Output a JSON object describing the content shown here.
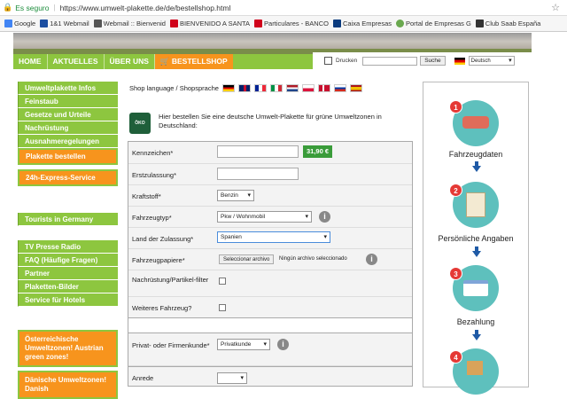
{
  "browser": {
    "security_label": "Es seguro",
    "url": "https://www.umwelt-plakette.de/de/bestellshop.html"
  },
  "bookmarks": [
    {
      "label": "Google",
      "color": "#4285f4"
    },
    {
      "label": "1&1 Webmail",
      "color": "#1c4fa1"
    },
    {
      "label": "Webmail :: Bienvenid",
      "color": "#555555"
    },
    {
      "label": "BIENVENIDO A SANTA",
      "color": "#d0021b"
    },
    {
      "label": "Particulares - BANCO",
      "color": "#d0021b"
    },
    {
      "label": "Caixa Empresas",
      "color": "#0a3b7e"
    },
    {
      "label": "Portal de Empresas G",
      "color": "#6aa84f"
    },
    {
      "label": "Club Saab España",
      "color": "#333333"
    }
  ],
  "nav": {
    "tabs": [
      "HOME",
      "AKTUELLES",
      "ÜBER UNS",
      "BESTELLSHOP"
    ],
    "print_label": "Drucken",
    "search_button": "Suche",
    "language_select": "Deutsch"
  },
  "sidebar": {
    "group1": [
      "Umweltplakette Infos",
      "Feinstaub",
      "Gesetze und Urteile",
      "Nachrüstung",
      "Ausnahmeregelungen"
    ],
    "order_button": "Plakette bestellen",
    "express_button": "24h-Express-Service",
    "group2": [
      "Tourists in Germany"
    ],
    "group3": [
      "TV Presse Radio",
      "FAQ (Häufige Fragen)",
      "Partner",
      "Plaketten-Bilder",
      "Service für Hotels"
    ],
    "promo1": "Österreichische Umweltzonen! Austrian green zones!",
    "promo2": "Dänische Umweltzonen! Danish"
  },
  "shop_language": {
    "label": "Shop language / Shopsprache",
    "flags": [
      "de",
      "gb",
      "fr",
      "it",
      "nl",
      "pl",
      "dk",
      "ru",
      "es"
    ]
  },
  "intro": {
    "logo_text": "ÖKO PLAKETTE",
    "text": "Hier bestellen Sie eine deutsche Umwelt-Plakette für grüne Umweltzonen in Deutschland:"
  },
  "form": {
    "kennzeichen_label": "Kennzeichen*",
    "price": "31,90 €",
    "erstzulassung_label": "Erstzulassung*",
    "kraftstoff_label": "Kraftstoff*",
    "kraftstoff_value": "Benzin",
    "fahrzeugtyp_label": "Fahrzeugtyp*",
    "fahrzeugtyp_value": "Pkw / Wohnmobil",
    "land_label": "Land der Zulassung*",
    "land_value": "Spanien",
    "papiere_label": "Fahrzeugpapiere*",
    "file_button": "Seleccionar archivo",
    "file_status": "Ningún archivo seleccionado",
    "nachruestung_label": "Nachrüstung/Partikel-filter",
    "weiteres_label": "Weiteres Fahrzeug?",
    "kunde_label": "Privat- oder Firmenkunde*",
    "kunde_value": "Privatkunde",
    "anrede_label": "Anrede"
  },
  "process": {
    "steps": [
      {
        "num": "1",
        "label": "Fahrzeugdaten"
      },
      {
        "num": "2",
        "label": "Persönliche Angaben"
      },
      {
        "num": "3",
        "label": "Bezahlung"
      },
      {
        "num": "4",
        "label": ""
      }
    ]
  },
  "colors": {
    "green": "#8dc63f",
    "orange": "#f7941d",
    "teal": "#5ec0bd",
    "step_red": "#e53935",
    "arrow_blue": "#1f5aa6"
  }
}
